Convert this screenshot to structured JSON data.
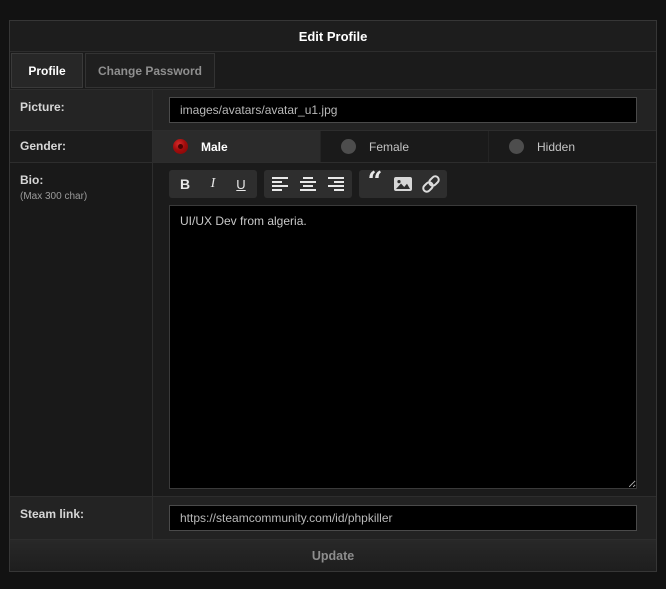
{
  "window": {
    "title": "Edit Profile"
  },
  "tabs": [
    {
      "label": "Profile",
      "active": true
    },
    {
      "label": "Change Password",
      "active": false
    }
  ],
  "form": {
    "picture": {
      "label": "Picture:",
      "value": "images/avatars/avatar_u1.jpg"
    },
    "gender": {
      "label": "Gender:",
      "options": [
        {
          "label": "Male",
          "selected": true
        },
        {
          "label": "Female",
          "selected": false
        },
        {
          "label": "Hidden",
          "selected": false
        }
      ]
    },
    "bio": {
      "label": "Bio:",
      "hint": "(Max 300 char)",
      "value": "UI/UX Dev from algeria.",
      "toolbar": {
        "bold_glyph": "B",
        "italic_glyph": "I",
        "underline_glyph": "U",
        "quote_glyph": "“",
        "icons": [
          "bold",
          "italic",
          "underline",
          "align-left",
          "align-center",
          "align-right",
          "quote",
          "image",
          "link"
        ]
      }
    },
    "steam": {
      "label": "Steam link:",
      "value": "https://steamcommunity.com/id/phpkiller"
    }
  },
  "actions": {
    "update_label": "Update"
  },
  "colors": {
    "page_bg": "#121212",
    "panel_bg": "#1c1c1c",
    "input_bg": "#000000",
    "accent_red": "#a30d0d",
    "active_text": "#ffffff",
    "muted_text": "#8f8f8f"
  }
}
